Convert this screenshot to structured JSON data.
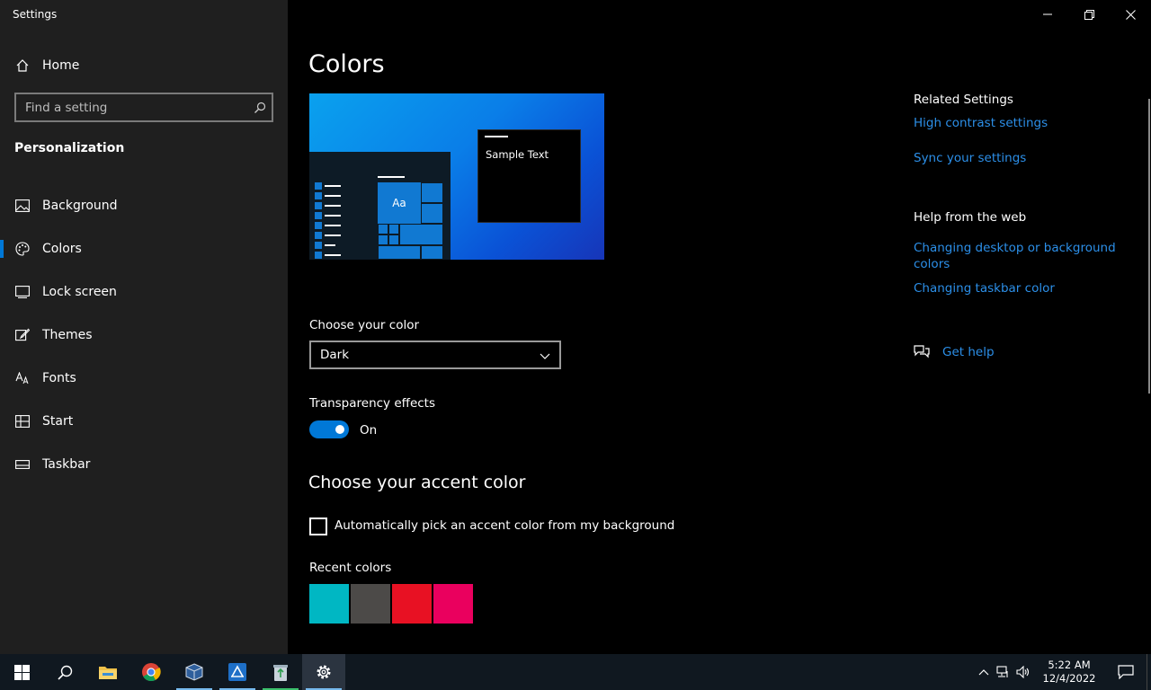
{
  "window": {
    "title": "Settings"
  },
  "sidebar": {
    "home_label": "Home",
    "search_placeholder": "Find a setting",
    "section_title": "Personalization",
    "items": [
      {
        "label": "Background",
        "icon": "picture-icon"
      },
      {
        "label": "Colors",
        "icon": "palette-icon",
        "selected": true
      },
      {
        "label": "Lock screen",
        "icon": "lock-screen-icon"
      },
      {
        "label": "Themes",
        "icon": "brush-icon"
      },
      {
        "label": "Fonts",
        "icon": "font-icon"
      },
      {
        "label": "Start",
        "icon": "start-icon"
      },
      {
        "label": "Taskbar",
        "icon": "taskbar-icon"
      }
    ]
  },
  "main": {
    "title": "Colors",
    "preview": {
      "aa": "Aa",
      "sample_text": "Sample Text"
    },
    "choose_color_label": "Choose your color",
    "choose_color_value": "Dark",
    "transparency_label": "Transparency effects",
    "transparency_state": "On",
    "accent_title": "Choose your accent color",
    "auto_accent_label": "Automatically pick an accent color from my background",
    "recent_colors_label": "Recent colors",
    "recent_colors": [
      "#00b7c3",
      "#4c4a48",
      "#e81123",
      "#ea005e"
    ]
  },
  "related": {
    "heading": "Related Settings",
    "links": [
      "High contrast settings",
      "Sync your settings"
    ],
    "help_heading": "Help from the web",
    "help_links": [
      "Changing desktop or background colors",
      "Changing taskbar color"
    ],
    "get_help": "Get help"
  },
  "taskbar": {
    "apps": [
      "start",
      "search",
      "file-explorer",
      "chrome",
      "virtualbox",
      "app",
      "recycle-app",
      "settings"
    ],
    "time": "5:22 AM",
    "date": "12/4/2022"
  },
  "colors": {
    "accent": "#0078d7",
    "link": "#2c8fe8"
  }
}
